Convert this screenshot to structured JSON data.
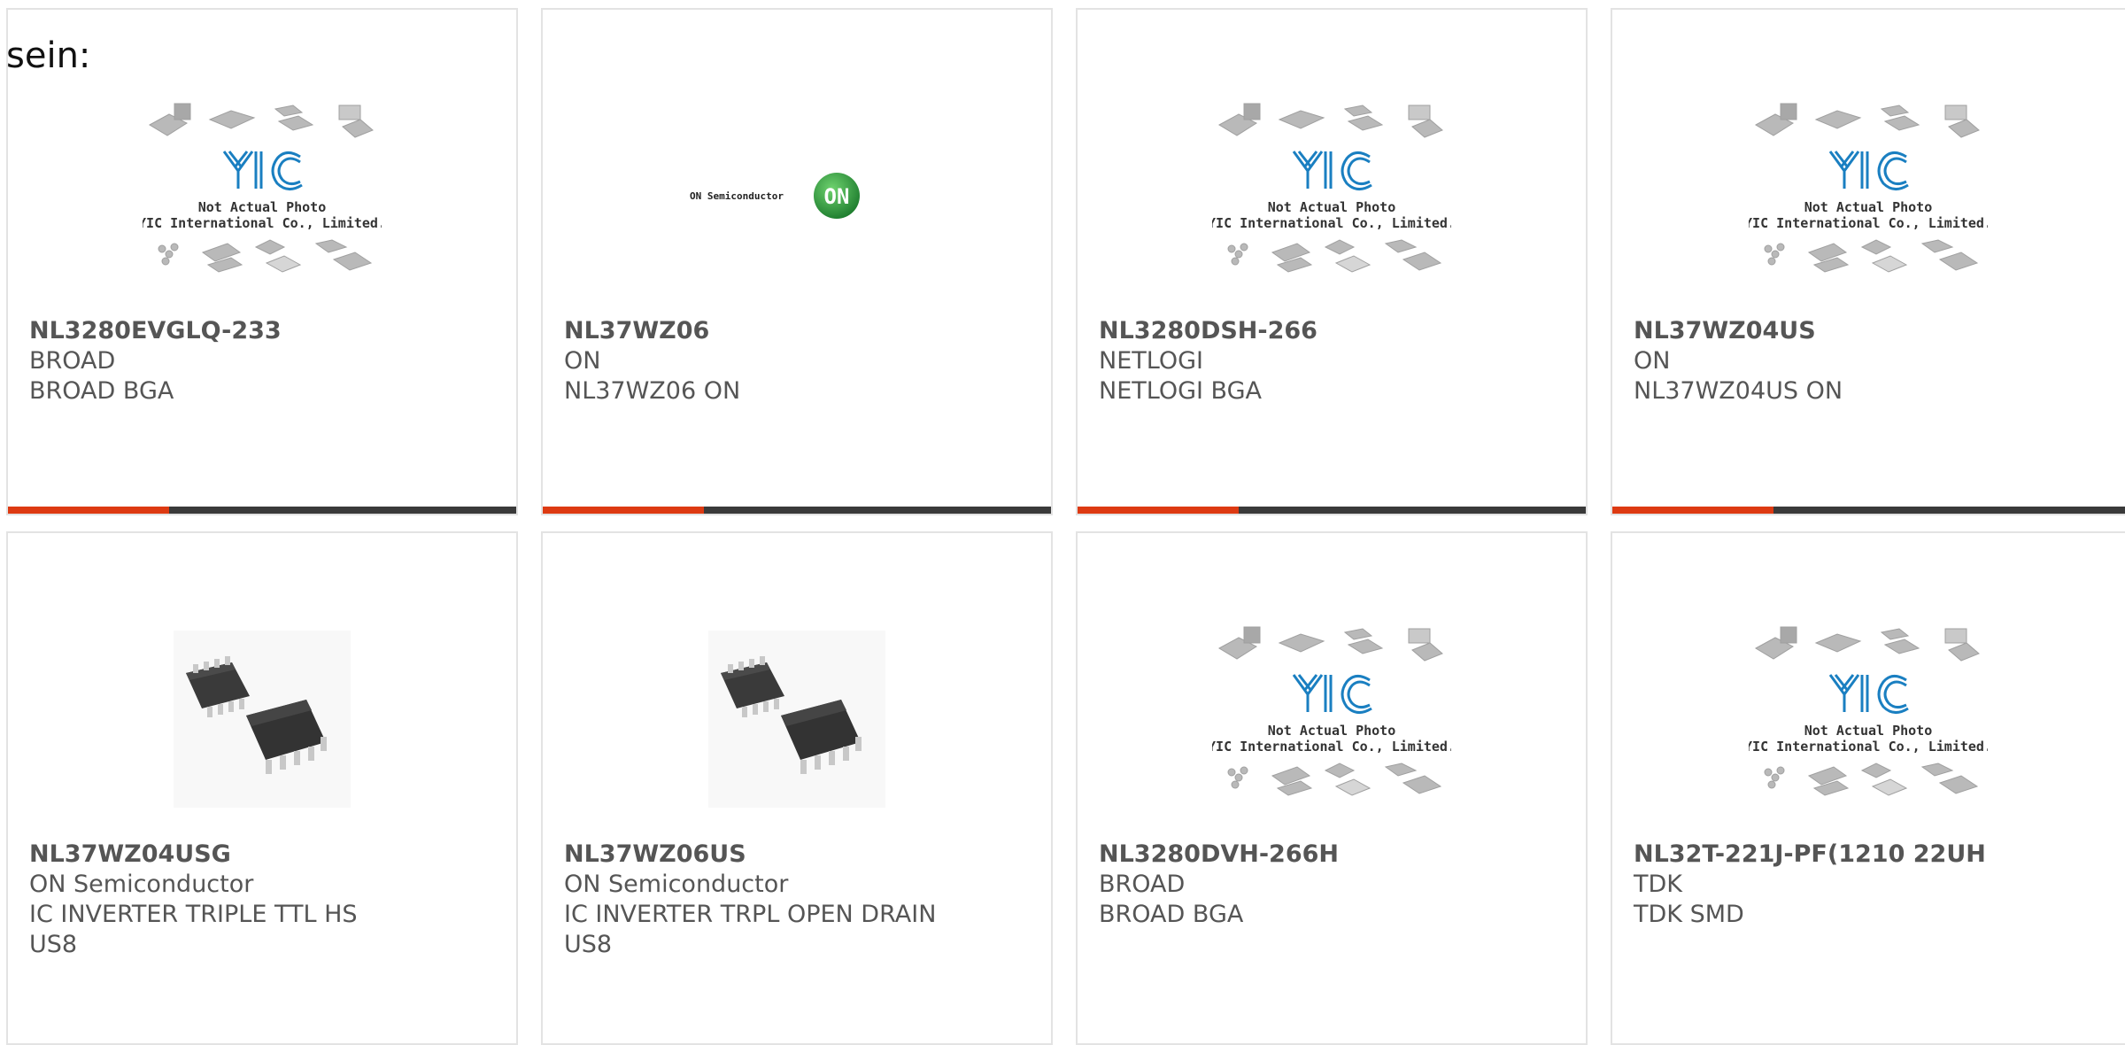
{
  "prefix_text": "sein:",
  "placeholder_caption": {
    "line1": "Not Actual Photo",
    "line2": "YIC International Co., Limited."
  },
  "on_logo_text": "ON Semiconductor",
  "on_badge_text": "ON",
  "products": [
    {
      "part": "NL3280EVGLQ-233",
      "mfr": "BROAD",
      "desc": "BROAD BGA",
      "image": "yic-placeholder"
    },
    {
      "part": "NL37WZ06",
      "mfr": "ON",
      "desc": "NL37WZ06 ON",
      "image": "on-semi-logo"
    },
    {
      "part": "NL3280DSH-266",
      "mfr": "NETLOGI",
      "desc": "NETLOGI BGA",
      "image": "yic-placeholder"
    },
    {
      "part": "NL37WZ04US",
      "mfr": "ON",
      "desc": "NL37WZ04US ON",
      "image": "yic-placeholder"
    },
    {
      "part": "NL37WZ04USG",
      "mfr": "ON Semiconductor",
      "desc": "IC INVERTER TRIPLE TTL HS US8",
      "image": "chip-photo"
    },
    {
      "part": "NL37WZ06US",
      "mfr": "ON Semiconductor",
      "desc": "IC INVERTER TRPL OPEN DRAIN US8",
      "image": "chip-photo"
    },
    {
      "part": "NL3280DVH-266H",
      "mfr": "BROAD",
      "desc": "BROAD BGA",
      "image": "yic-placeholder"
    },
    {
      "part": "NL32T-221J-PF(1210 22UH",
      "mfr": "TDK",
      "desc": "TDK SMD",
      "image": "yic-placeholder"
    }
  ],
  "colors": {
    "accent": "#dd3a12",
    "bar": "#3a3a3a",
    "text": "#555555",
    "yic_blue": "#1a7fc1"
  }
}
